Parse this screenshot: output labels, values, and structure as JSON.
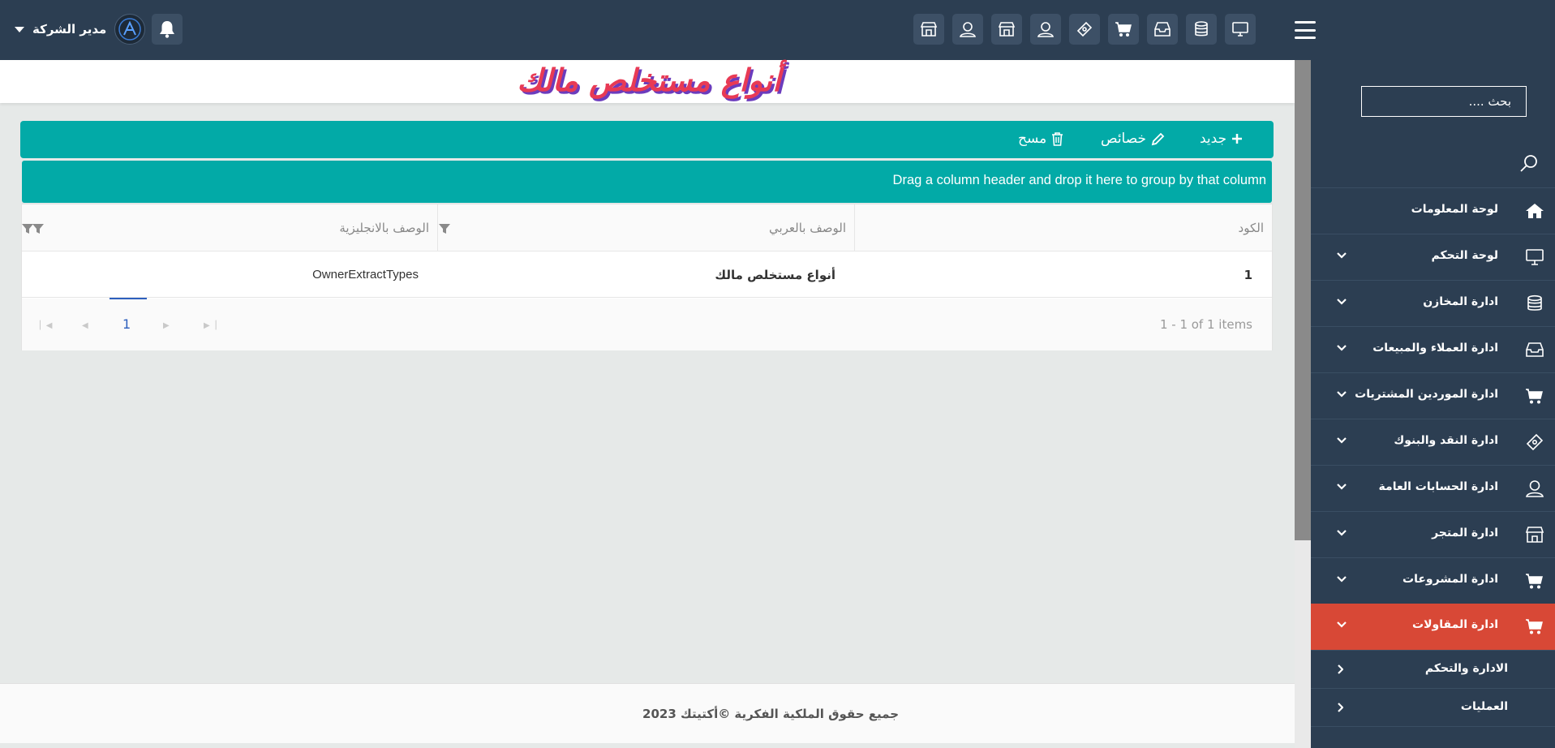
{
  "colors": {
    "topbar": "#2c3e52",
    "sidebar": "#2c3e52",
    "accent_teal": "#02aaa7",
    "active_menu": "#d84836",
    "title_red": "#e83a55",
    "title_shadow": "#6b3cbd",
    "pager_link": "#2d5fbd"
  },
  "header": {
    "user_name": "مدير الشركة",
    "top_icons": [
      "monitor-icon",
      "database-icon",
      "inbox-icon",
      "cart-icon",
      "money-icon",
      "user-icon",
      "store-icon",
      "user-icon",
      "store-icon"
    ]
  },
  "page": {
    "title": "أنواع مستخلص مالك"
  },
  "toolbar": {
    "new_label": "جديد",
    "props_label": "خصائص",
    "delete_label": "مسح"
  },
  "grid": {
    "group_hint": "Drag a column header and drop it here to group by that column",
    "columns": [
      "الكود",
      "الوصف بالعربي",
      "الوصف بالانجليزية"
    ],
    "rows": [
      {
        "code": "1",
        "arabic": "أنواع مستخلص مالك",
        "english": "OwnerExtractTypes"
      }
    ],
    "pager": {
      "current_page": "1",
      "info": "1 - 1 of 1 items"
    }
  },
  "footer": {
    "text": "جميع حقوق الملكية الفكرية ©أكتيتك 2023"
  },
  "sidebar": {
    "search_placeholder": "بحث ....",
    "items": [
      {
        "label": "لوحة المعلومات",
        "icon": "home-icon"
      },
      {
        "label": "لوحة التحكم",
        "icon": "monitor-icon"
      },
      {
        "label": "ادارة المخازن",
        "icon": "database-icon"
      },
      {
        "label": "ادارة العملاء والمبيعات",
        "icon": "inbox-icon"
      },
      {
        "label": "ادارة الموردين المشتريات",
        "icon": "cart-icon"
      },
      {
        "label": "ادارة النقد والبنوك",
        "icon": "money-icon"
      },
      {
        "label": "ادارة الحسابات العامة",
        "icon": "user-icon"
      },
      {
        "label": "ادارة المتجر",
        "icon": "store-icon"
      },
      {
        "label": "ادارة المشروعات",
        "icon": "cart-icon"
      },
      {
        "label": "ادارة المقاولات",
        "icon": "cart-icon",
        "active": true
      }
    ],
    "sub_items": [
      {
        "label": "الادارة والتحكم"
      },
      {
        "label": "العمليات"
      }
    ]
  }
}
